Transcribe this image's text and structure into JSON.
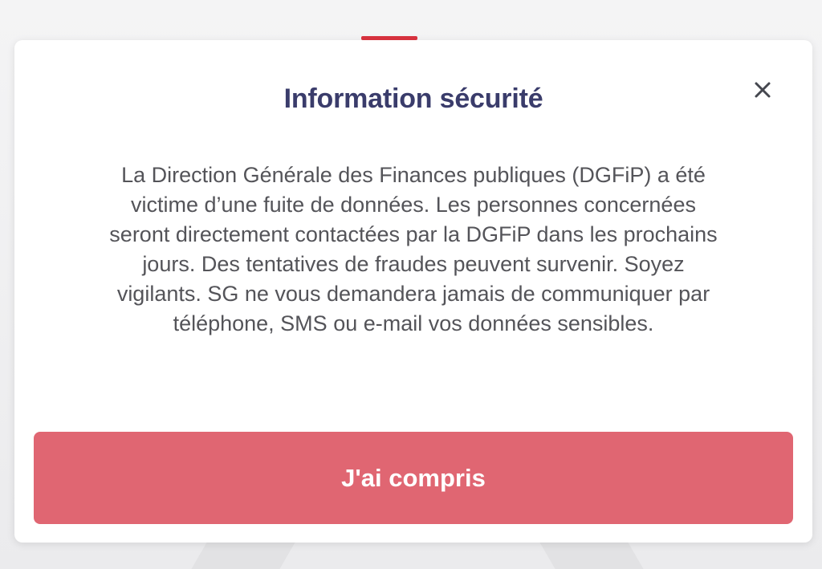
{
  "dialog": {
    "title": "Information sécurité",
    "message": "La Direction Générale des Finances publiques (DGFiP) a été victime d’une fuite de données. Les personnes concernées seront directement contactées par la DGFiP dans les prochains jours. Des tentatives de fraudes peuvent survenir. Soyez vigilants. SG ne vous demandera jamais de communiquer par téléphone, SMS ou e-mail vos données sensibles.",
    "confirm_label": "J'ai compris",
    "close_icon": "close-icon"
  },
  "colors": {
    "accent": "#d6323e",
    "title": "#3a3c6b",
    "button": "#e06672",
    "text": "#545459"
  }
}
